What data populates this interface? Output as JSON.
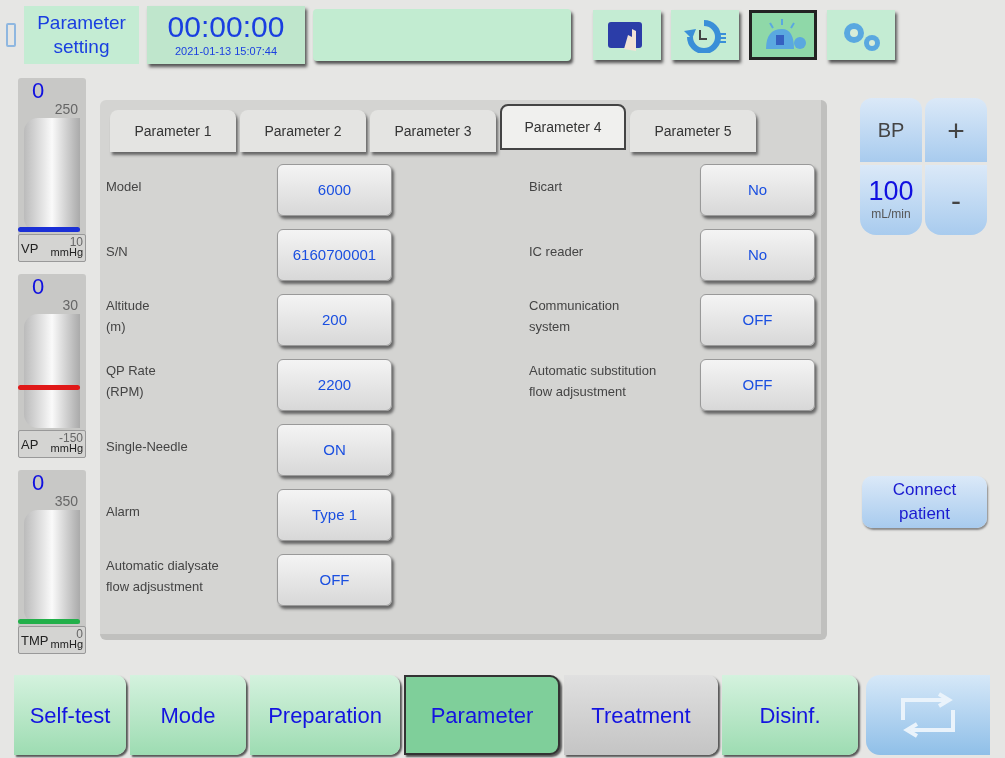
{
  "header": {
    "title": "Parameter setting",
    "timer": "00:00:00",
    "datetime": "2021-01-13 15:07:44",
    "icon_buttons": [
      {
        "kind": "hand",
        "selected": false
      },
      {
        "kind": "history",
        "selected": false
      },
      {
        "kind": "light",
        "selected": true
      },
      {
        "kind": "gears",
        "selected": false
      }
    ]
  },
  "gauges": [
    {
      "value": "0",
      "max": "250",
      "min": "10",
      "name": "VP",
      "unit": "mmHg",
      "color": "#1a2fd6",
      "level": 0
    },
    {
      "value": "0",
      "max": "30",
      "min": "-150",
      "name": "AP",
      "unit": "mmHg",
      "color": "#e01818",
      "level": 0.33
    },
    {
      "value": "0",
      "max": "350",
      "min": "0",
      "name": "TMP",
      "unit": "mmHg",
      "color": "#22b04a",
      "level": 0
    }
  ],
  "tabs": [
    {
      "label": "Parameter 1",
      "selected": false
    },
    {
      "label": "Parameter 2",
      "selected": false
    },
    {
      "label": "Parameter 3",
      "selected": false
    },
    {
      "label": "Parameter 4",
      "selected": true
    },
    {
      "label": "Parameter 5",
      "selected": false
    }
  ],
  "left_params": [
    {
      "label": "Model",
      "value": "6000"
    },
    {
      "label": "S/N",
      "value": "6160700001"
    },
    {
      "label": "Altitude\n(m)",
      "value": "200"
    },
    {
      "label": "QP Rate\n(RPM)",
      "value": "2200"
    },
    {
      "label": "Single-Needle",
      "value": "ON"
    },
    {
      "label": "Alarm",
      "value": "Type 1"
    },
    {
      "label": "Automatic dialysate\nflow adjsustment",
      "value": "OFF"
    }
  ],
  "right_params": [
    {
      "label": "Bicart",
      "value": "No"
    },
    {
      "label": "IC reader",
      "value": "No"
    },
    {
      "label": "Communication\nsystem",
      "value": "OFF"
    },
    {
      "label": "Automatic substitution\nflow adjsustment",
      "value": "OFF"
    }
  ],
  "blood_pump": {
    "label": "BP",
    "plus": "+",
    "value": "100",
    "unit": "mL/min",
    "minus": "-"
  },
  "connect_button": "Connect\npatient",
  "nav": [
    {
      "label": "Self-test",
      "selected": false,
      "disabled": false
    },
    {
      "label": "Mode",
      "selected": false,
      "disabled": false
    },
    {
      "label": "Preparation",
      "selected": false,
      "disabled": false
    },
    {
      "label": "Parameter",
      "selected": true,
      "disabled": false
    },
    {
      "label": "Treatment",
      "selected": false,
      "disabled": true
    },
    {
      "label": "Disinf.",
      "selected": false,
      "disabled": false
    }
  ]
}
